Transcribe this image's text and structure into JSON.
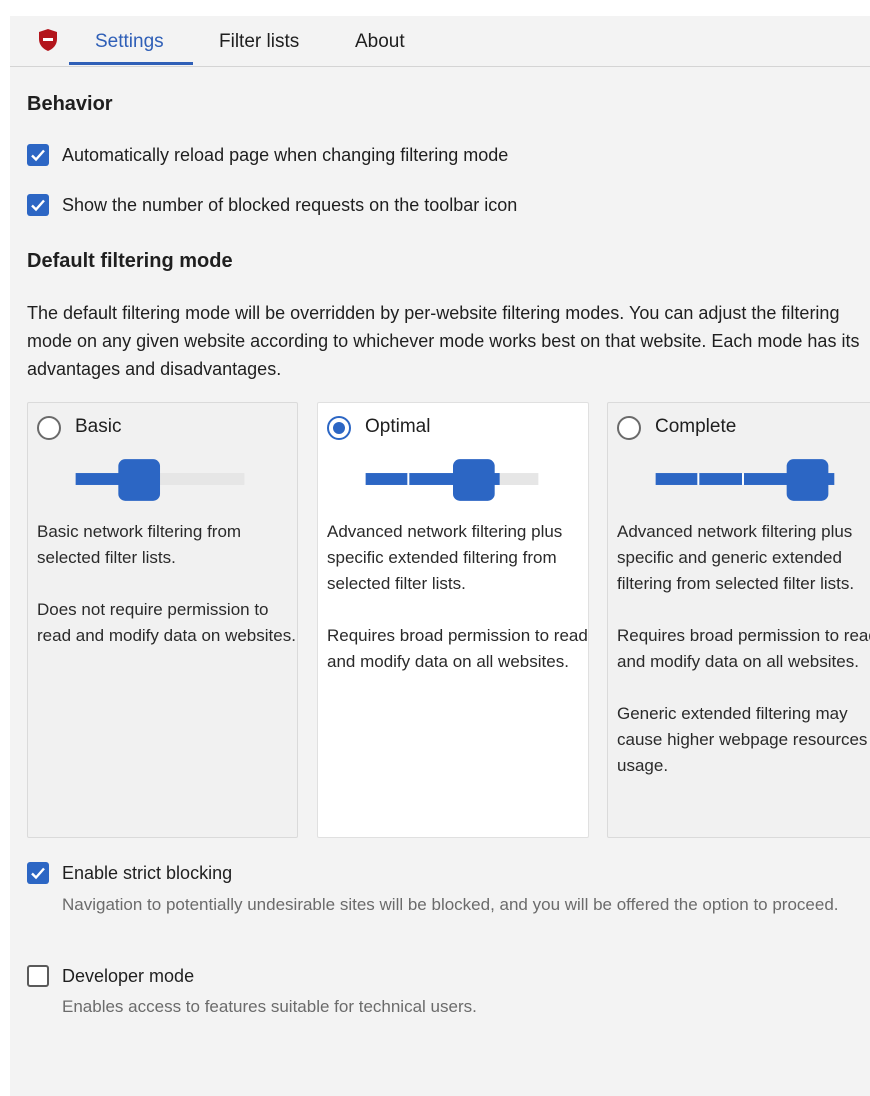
{
  "tabs": [
    {
      "label": "Settings",
      "active": true
    },
    {
      "label": "Filter lists",
      "active": false
    },
    {
      "label": "About",
      "active": false
    }
  ],
  "colors": {
    "accent": "#2c66c4",
    "logo": "#b3151c"
  },
  "behavior": {
    "heading": "Behavior",
    "auto_reload": {
      "label": "Automatically reload page when changing filtering mode",
      "checked": true
    },
    "show_count": {
      "label": "Show the number of blocked requests on the toolbar icon",
      "checked": true
    }
  },
  "filtering": {
    "heading": "Default filtering mode",
    "description": "The default filtering mode will be overridden by per-website filtering modes. You can adjust the filtering mode on any given website according to whichever mode works best on that website. Each mode has its advantages and disadvantages.",
    "modes": [
      {
        "name": "Basic",
        "selected": false,
        "level": 1,
        "text": [
          "Basic network filtering from selected filter lists.",
          "Does not require permission to read and modify data on websites."
        ]
      },
      {
        "name": "Optimal",
        "selected": true,
        "level": 2,
        "text": [
          "Advanced network filtering plus specific extended filtering from selected filter lists.",
          "Requires broad permission to read and modify data on all websites."
        ]
      },
      {
        "name": "Complete",
        "selected": false,
        "level": 3,
        "text": [
          "Advanced network filtering plus specific and generic extended filtering from selected filter lists.",
          "Requires broad permission to read and modify data on all websites.",
          "Generic extended filtering may cause higher webpage resources usage."
        ]
      }
    ]
  },
  "strict": {
    "label": "Enable strict blocking",
    "checked": true,
    "description": "Navigation to potentially undesirable sites will be blocked, and you will be offered the option to proceed."
  },
  "developer": {
    "label": "Developer mode",
    "checked": false,
    "description": "Enables access to features suitable for technical users."
  }
}
